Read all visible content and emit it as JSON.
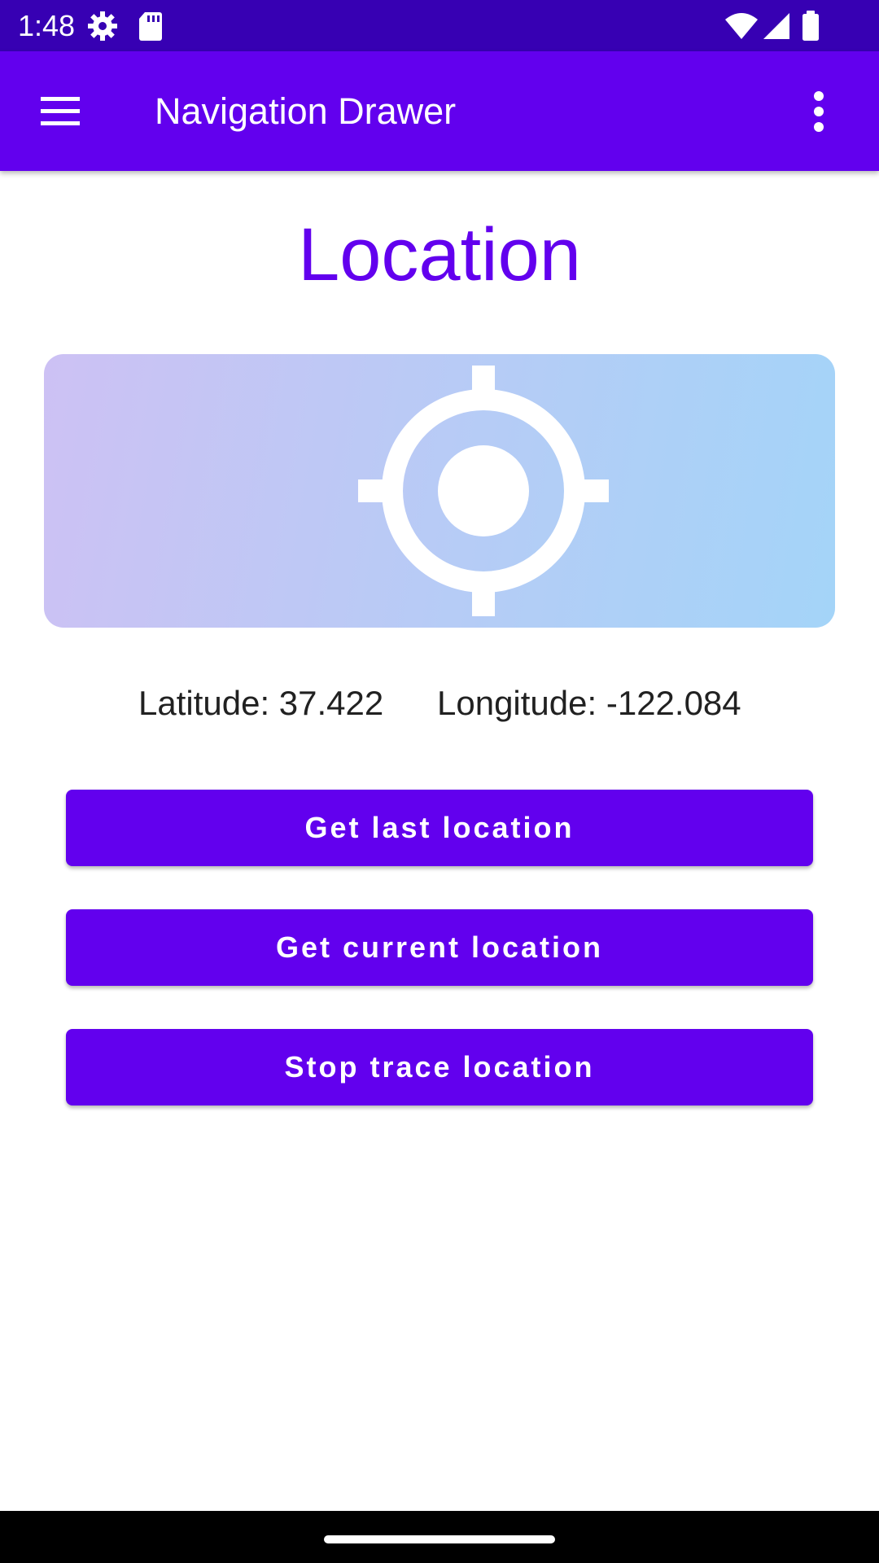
{
  "status_bar": {
    "time": "1:48",
    "icons": [
      "settings-gear-icon",
      "sd-card-icon",
      "wifi-icon",
      "cell-signal-icon",
      "battery-icon"
    ],
    "background": "#3700B3"
  },
  "app_bar": {
    "title": "Navigation Drawer",
    "menu_icon": "hamburger-menu-icon",
    "overflow_icon": "overflow-menu-icon",
    "background": "#6200EE"
  },
  "main": {
    "title": "Location",
    "card_icon": "gps-crosshair-icon",
    "latitude_text": "Latitude: 37.422",
    "longitude_text": "Longitude: -122.084",
    "buttons": [
      {
        "label": "Get last location"
      },
      {
        "label": "Get current location"
      },
      {
        "label": "Stop trace location"
      }
    ],
    "accent": "#6200EE"
  },
  "nav_bar": {
    "background": "#000000"
  }
}
